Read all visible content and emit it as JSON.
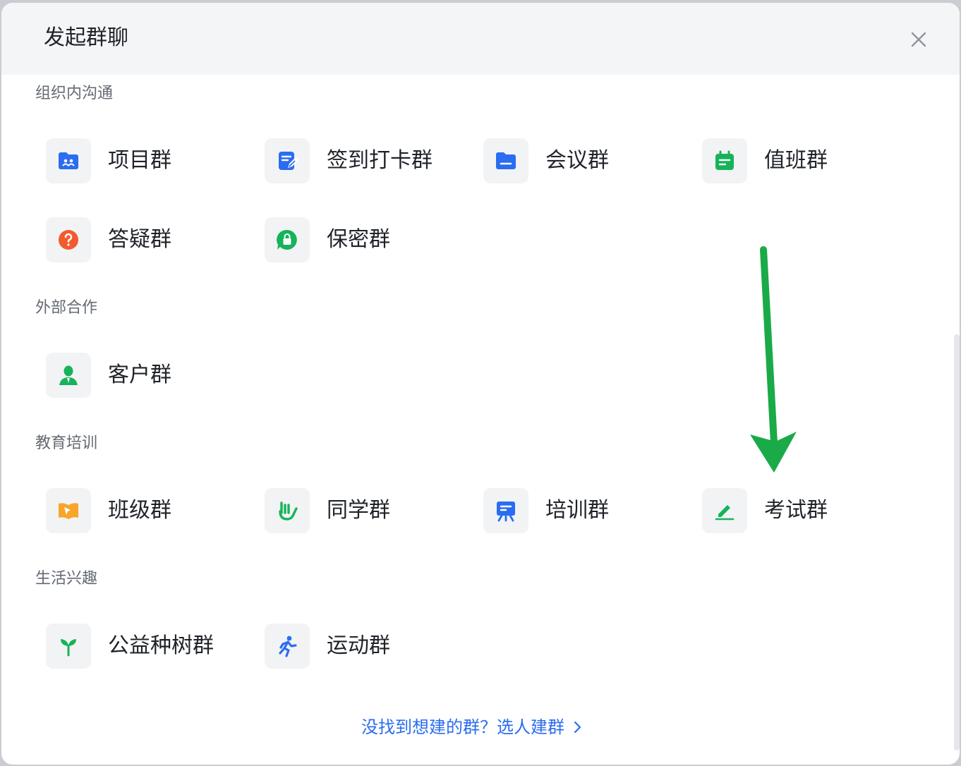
{
  "dialog": {
    "title": "发起群聊",
    "close_label": "×"
  },
  "sections": [
    {
      "title": "组织内沟通",
      "items": [
        {
          "label": "项目群",
          "icon": "project-folder-icon",
          "color": "#2b6df0"
        },
        {
          "label": "签到打卡群",
          "icon": "checkin-note-icon",
          "color": "#2b6df0"
        },
        {
          "label": "会议群",
          "icon": "meeting-folder-icon",
          "color": "#2b6df0"
        },
        {
          "label": "值班群",
          "icon": "calendar-icon",
          "color": "#16b35a"
        },
        {
          "label": "答疑群",
          "icon": "question-icon",
          "color": "#f35a2f"
        },
        {
          "label": "保密群",
          "icon": "lock-bubble-icon",
          "color": "#16b35a"
        }
      ]
    },
    {
      "title": "外部合作",
      "items": [
        {
          "label": "客户群",
          "icon": "customer-icon",
          "color": "#16b35a"
        }
      ]
    },
    {
      "title": "教育培训",
      "items": [
        {
          "label": "班级群",
          "icon": "book-icon",
          "color": "#f7a62b"
        },
        {
          "label": "同学群",
          "icon": "hand-gesture-icon",
          "color": "#16b35a"
        },
        {
          "label": "培训群",
          "icon": "easel-icon",
          "color": "#2b6df0"
        },
        {
          "label": "考试群",
          "icon": "pencil-icon",
          "color": "#16b35a"
        }
      ]
    },
    {
      "title": "生活兴趣",
      "items": [
        {
          "label": "公益种树群",
          "icon": "sprout-icon",
          "color": "#16b35a"
        },
        {
          "label": "运动群",
          "icon": "runner-icon",
          "color": "#2b6df0"
        }
      ]
    }
  ],
  "footer": {
    "link_text": "没找到想建的群？选人建群"
  },
  "annotation": {
    "arrow_color": "#1aaa48"
  }
}
